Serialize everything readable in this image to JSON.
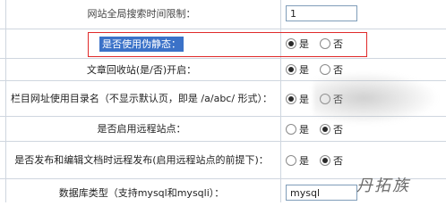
{
  "rows": [
    {
      "label": "网站全局搜索时间限制：",
      "type": "input",
      "value": "1"
    },
    {
      "label": "是否使用伪静态：",
      "type": "radio",
      "options": [
        "是",
        "否"
      ],
      "selected": 0
    },
    {
      "label": "文章回收站(是/否)开启：",
      "type": "radio",
      "options": [
        "是",
        "否"
      ],
      "selected": 0
    },
    {
      "label": "栏目网址使用目录名（不显示默认页，即是 /a/abc/ 形式）：",
      "type": "radio",
      "options": [
        "是",
        "否"
      ],
      "selected": 0
    },
    {
      "label": "是否启用远程站点：",
      "type": "radio",
      "options": [
        "是",
        "否"
      ],
      "selected": 1
    },
    {
      "label": "是否发布和编辑文档时远程发布(启用远程站点的前提下)：",
      "type": "radio",
      "options": [
        "是",
        "否"
      ],
      "selected": 1
    },
    {
      "label": "数据库类型（支持mysql和mysqli）：",
      "type": "input",
      "value": "mysql"
    }
  ],
  "watermark": "丹拓族",
  "colors": {
    "highlight": "#3b72c8",
    "red_box": "#e02a2a",
    "grid": "#cfd6df"
  }
}
